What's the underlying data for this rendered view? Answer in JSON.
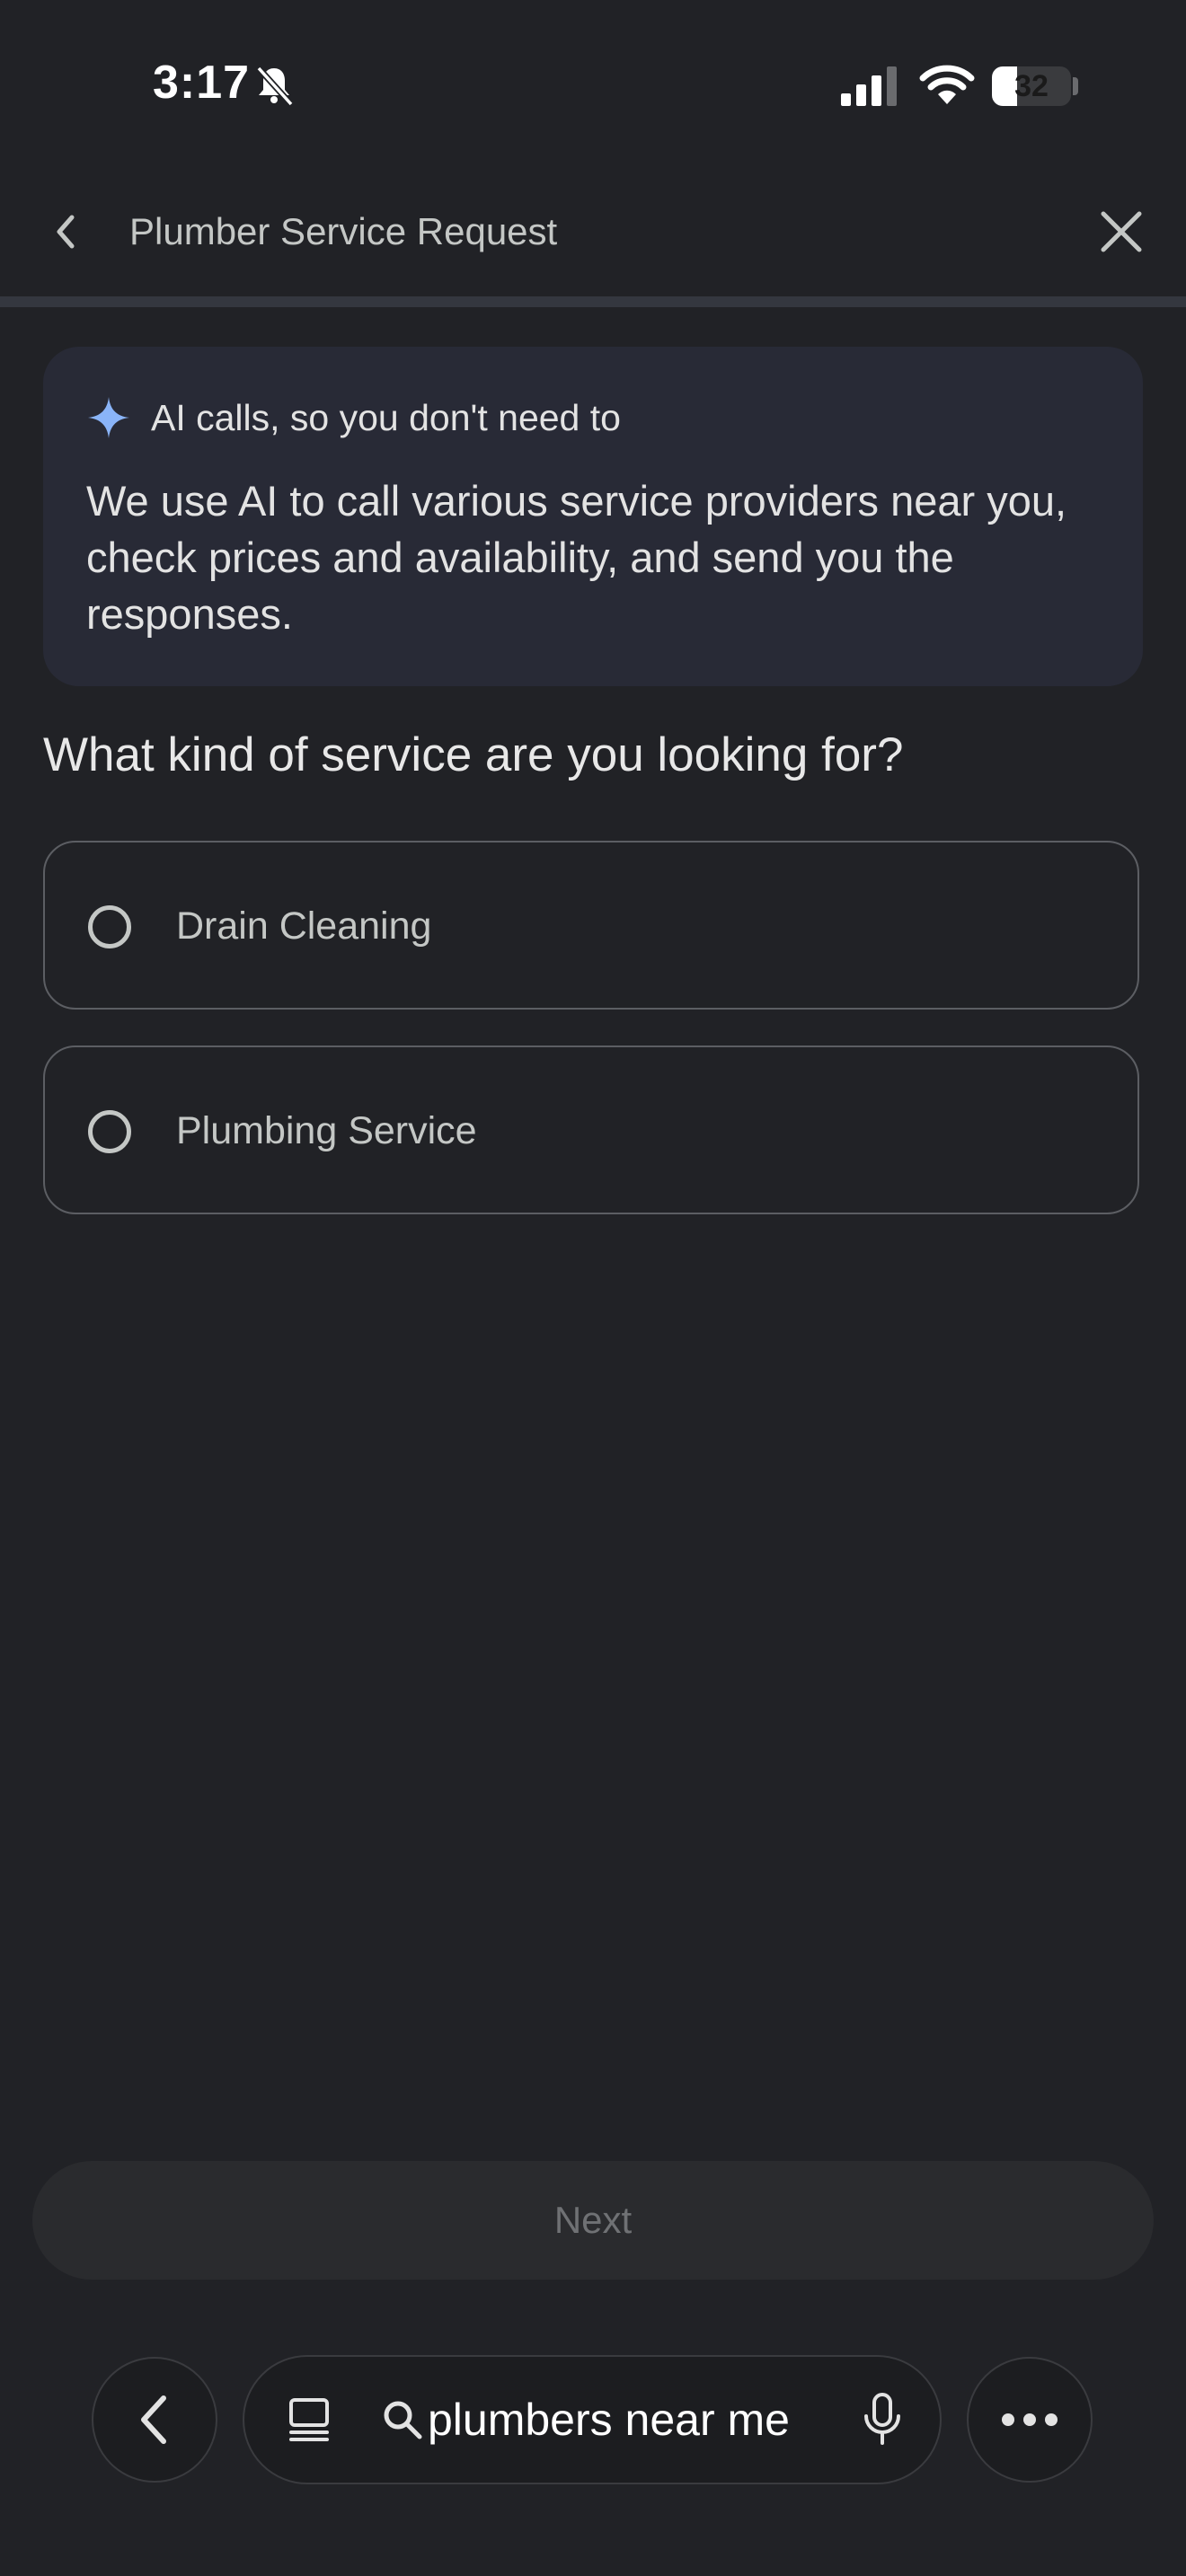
{
  "status_bar": {
    "time": "3:17",
    "battery_level": "32",
    "battery_fraction": 0.32,
    "icons": [
      "bell-off-icon",
      "cellular-signal-icon",
      "wifi-icon",
      "battery-icon"
    ]
  },
  "header": {
    "title": "Plumber Service Request",
    "back_icon": "chevron-left-icon",
    "close_icon": "close-icon"
  },
  "info_card": {
    "title": "AI calls, so you don't need to",
    "body": "We use AI to call various service providers near you, check prices and availability, and send you the responses.",
    "icon": "sparkle-icon",
    "icon_color": "#8ab4f8"
  },
  "question": "What kind of service are you looking for?",
  "options": [
    {
      "label": "Drain Cleaning",
      "selected": false
    },
    {
      "label": "Plumbing Service",
      "selected": false
    }
  ],
  "next_button": {
    "label": "Next",
    "enabled": false
  },
  "toolbar": {
    "search_query": "plumbers near me",
    "icons": [
      "back-icon",
      "tabs-icon",
      "search-icon",
      "mic-icon",
      "more-icon"
    ]
  },
  "colors": {
    "background": "#212226",
    "card": "#282a36",
    "accent": "#8ab4f8"
  }
}
